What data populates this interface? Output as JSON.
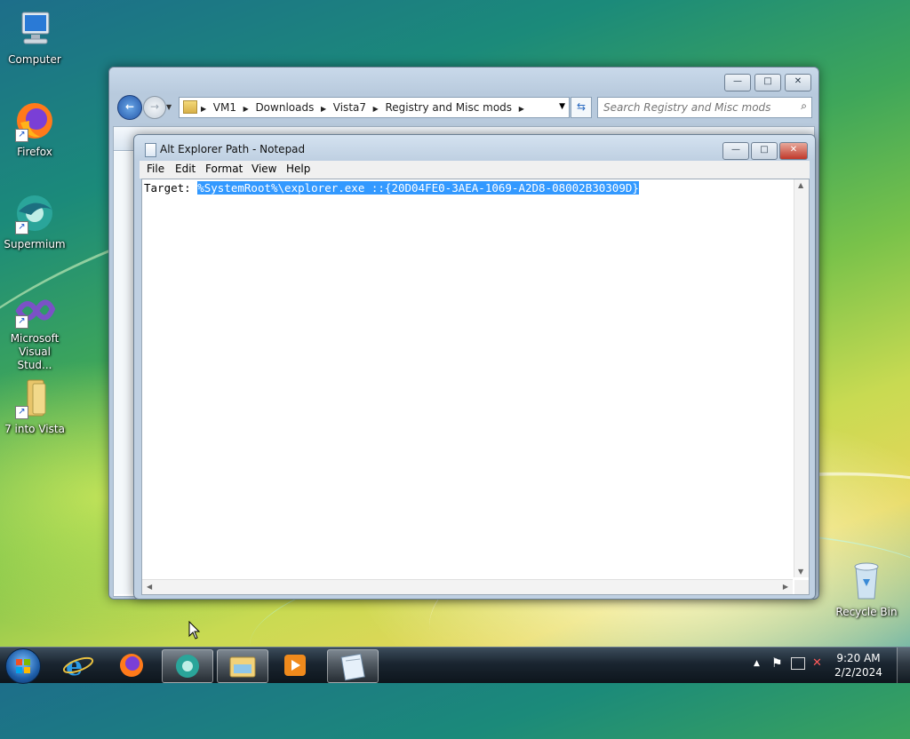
{
  "desktop": {
    "icons": [
      {
        "label": "Computer",
        "icon": "computer-icon"
      },
      {
        "label": "Firefox",
        "icon": "firefox-icon"
      },
      {
        "label": "Supermium",
        "icon": "supermium-icon"
      },
      {
        "label": "Microsoft Visual Stud...",
        "icon": "visual-studio-icon"
      },
      {
        "label": "7 into Vista",
        "icon": "folder-icon"
      },
      {
        "label": "Recycle Bin",
        "icon": "recycle-bin-icon"
      }
    ]
  },
  "explorer": {
    "breadcrumb": [
      "VM1",
      "Downloads",
      "Vista7",
      "Registry and Misc mods"
    ],
    "search_placeholder": "Search Registry and Misc mods",
    "controls": {
      "minimize": "—",
      "maximize": "□",
      "close": "✕"
    }
  },
  "notepad": {
    "title": "Alt Explorer Path - Notepad",
    "menu": [
      "File",
      "Edit",
      "Format",
      "View",
      "Help"
    ],
    "content_prefix": "Target: ",
    "content_selected": "%SystemRoot%\\explorer.exe ::{20D04FE0-3AEA-1069-A2D8-08002B30309D}",
    "controls": {
      "minimize": "—",
      "maximize": "□",
      "close": "✕"
    }
  },
  "taskbar": {
    "pinned": [
      "start-orb-icon",
      "internet-explorer-icon",
      "firefox-icon",
      "supermium-icon",
      "windows-explorer-icon",
      "media-player-icon",
      "notepad-icon"
    ],
    "clock_time": "9:20 AM",
    "clock_date": "2/2/2024"
  },
  "colors": {
    "selection": "#3399ff",
    "taskbar": "#1a2530"
  }
}
